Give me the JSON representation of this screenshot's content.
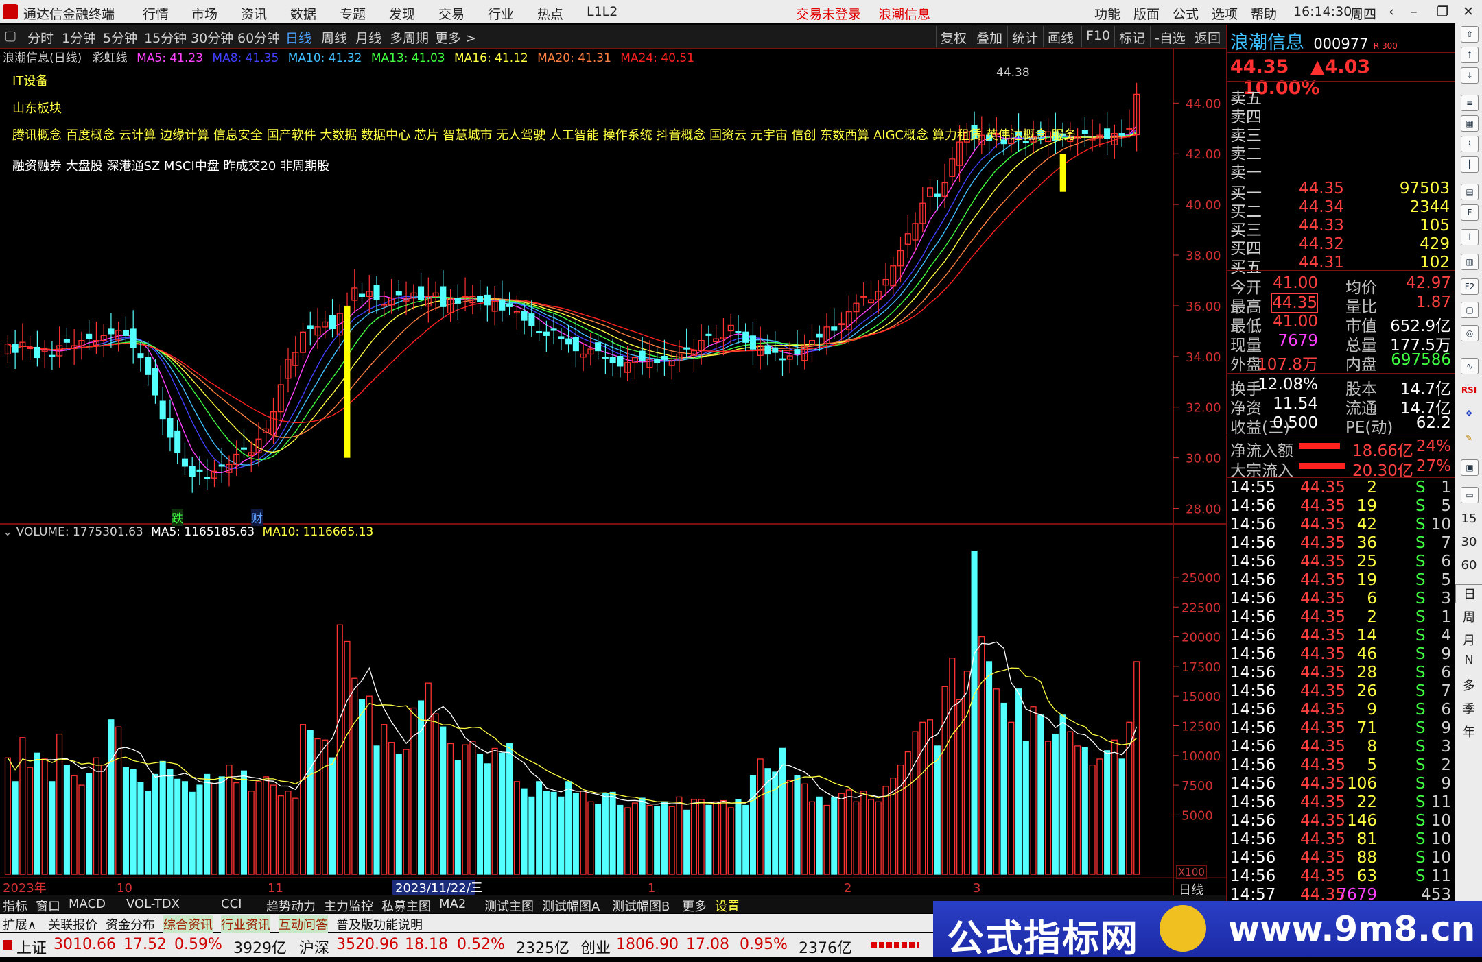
{
  "app": {
    "title": "通达信金融终端",
    "menu": [
      "行情",
      "市场",
      "资讯",
      "数据",
      "专题",
      "发现",
      "交易",
      "行业",
      "热点",
      "L1L2"
    ],
    "status_left": "交易未登录",
    "status_right": "浪潮信息",
    "right_menu": [
      "功能",
      "版面",
      "公式",
      "选项",
      "帮助"
    ],
    "clock": "16:14:30",
    "weekday": "周四"
  },
  "toolbar": {
    "periods": [
      "分时",
      "1分钟",
      "5分钟",
      "15分钟",
      "30分钟",
      "60分钟",
      "日线",
      "周线",
      "月线",
      "多周期",
      "更多 >"
    ],
    "active": "日线",
    "right_buttons": [
      "复权",
      "叠加",
      "统计",
      "画线",
      "F10",
      "标记",
      "-自选",
      "返回"
    ]
  },
  "chart_header": {
    "stock": "浪潮信息(日线)",
    "indicator": "彩虹线",
    "ma": [
      {
        "label": "MA5: 41.23",
        "color": "#ff40ff"
      },
      {
        "label": "MA8: 41.35",
        "color": "#4040ff"
      },
      {
        "label": "MA10: 41.32",
        "color": "#40c0ff"
      },
      {
        "label": "MA13: 41.03",
        "color": "#40ff40"
      },
      {
        "label": "MA16: 41.12",
        "color": "#ffff40"
      },
      {
        "label": "MA20: 41.31",
        "color": "#ff8040"
      },
      {
        "label": "MA24: 40.51",
        "color": "#ff2020"
      }
    ]
  },
  "tags": {
    "line1": "IT设备",
    "line2": "山东板块",
    "line3": "腾讯概念 百度概念 云计算 边缘计算 信息安全 国产软件 大数据 数据中心 芯片 智慧城市 无人驾驶 人工智能 操作系统 抖音概念 国资云 元宇宙 信创 东数西算 AIGC概念 算力租赁 英伟达概念 服务",
    "line4": "融资融券 大盘股 深港通SZ MSCI中盘 昨成交20 非周期股"
  },
  "chart_data": [
    {
      "type": "line",
      "name": "price",
      "y_ticks": [
        "44.00",
        "42.00",
        "40.00",
        "38.00",
        "36.00",
        "34.00",
        "32.00",
        "30.00",
        "28.00"
      ],
      "ylim": [
        27.5,
        45.2
      ],
      "high_label": "44.38",
      "markers": [
        "跌",
        "财"
      ]
    },
    {
      "type": "bar",
      "name": "volume",
      "title": "VOLUME: 1775301.63",
      "ma5": "MA5: 1165185.63",
      "ma10": "MA10: 1116665.13",
      "y_ticks": [
        "25000",
        "22500",
        "20000",
        "17500",
        "15000",
        "12500",
        "10000",
        "7500",
        "5000"
      ],
      "unit": "X100",
      "x_labels": [
        "2023年",
        "10",
        "11",
        "2023/11/22/三",
        "1",
        "2",
        "3"
      ],
      "period_label": "日线",
      "volumes": [
        9800,
        7800,
        11500,
        9000,
        10200,
        9700,
        7800,
        11800,
        9200,
        8300,
        7500,
        8500,
        9800,
        9200,
        13000,
        12400,
        9000,
        8800,
        7700,
        7000,
        8400,
        9500,
        8800,
        8000,
        7800,
        6900,
        7500,
        8400,
        7600,
        8200,
        9200,
        7700,
        8700,
        7000,
        7800,
        8200,
        7500,
        6600,
        7000,
        6400,
        12600,
        12100,
        11400,
        11300,
        9800,
        21000,
        19600,
        16500,
        14700,
        15000,
        10800,
        12600,
        11100,
        10100,
        10500,
        14000,
        14600,
        16100,
        13500,
        12400,
        11000,
        9600,
        10900,
        11200,
        10100,
        9300,
        10600,
        10200,
        11000,
        7800,
        7200,
        6500,
        7800,
        7000,
        6900,
        6500,
        7800,
        6800,
        7000,
        6100,
        5900,
        6800,
        6900,
        5800,
        5600,
        6000,
        6400,
        5800,
        5700,
        6100,
        5700,
        6500,
        5400,
        6300,
        6300,
        5800,
        6100,
        6200,
        5600,
        6300,
        5800,
        8300,
        9700,
        8900,
        8600,
        10600,
        7900,
        8300,
        7600,
        6100,
        6500,
        5800,
        6500,
        6800,
        7100,
        6100,
        7000,
        6300,
        6100,
        7400,
        8100,
        9200,
        10300,
        12000,
        12800,
        13000,
        10800,
        15800,
        18200,
        14700,
        17100,
        27200,
        20000,
        17900,
        15600,
        14400,
        12800,
        15600,
        11200,
        14100,
        13400,
        11200,
        11800,
        13400,
        12000,
        10800,
        10700,
        9200,
        9700,
        10400,
        11300,
        9700,
        12800,
        17900
      ]
    }
  ],
  "quote": {
    "name": "浪潮信息",
    "code": "000977",
    "code_mark": "R 300",
    "price": "44.35",
    "change": "▲4.03",
    "pct": "10.00%",
    "sell": [
      {
        "k": "卖五"
      },
      {
        "k": "卖四"
      },
      {
        "k": "卖三"
      },
      {
        "k": "卖二"
      },
      {
        "k": "卖一"
      }
    ],
    "buy": [
      {
        "k": "买一",
        "p": "44.35",
        "v": "97503"
      },
      {
        "k": "买二",
        "p": "44.34",
        "v": "2344"
      },
      {
        "k": "买三",
        "p": "44.33",
        "v": "105"
      },
      {
        "k": "买四",
        "p": "44.32",
        "v": "429"
      },
      {
        "k": "买五",
        "p": "44.31",
        "v": "102"
      }
    ],
    "stats": [
      {
        "l1": "今开",
        "v1": "41.00",
        "l2": "均价",
        "v2": "42.97"
      },
      {
        "l1": "最高",
        "v1": "44.35",
        "l2": "量比",
        "v2": "1.87"
      },
      {
        "l1": "最低",
        "v1": "41.00",
        "l2": "市值",
        "v2": "652.9亿"
      },
      {
        "l1": "现量",
        "v1": "7679",
        "l2": "总量",
        "v2": "177.5万"
      },
      {
        "l1": "外盘",
        "v1": "107.8万",
        "l2": "内盘",
        "v2": "697586"
      }
    ],
    "stats2": [
      {
        "l1": "换手",
        "v1": "12.08%",
        "l2": "股本",
        "v2": "14.7亿"
      },
      {
        "l1": "净资",
        "v1": "11.54",
        "l2": "流通",
        "v2": "14.7亿"
      },
      {
        "l1": "收益(三)",
        "v1": "0.500",
        "l2": "PE(动)",
        "v2": "62.2"
      }
    ],
    "flows": [
      {
        "l": "净流入额",
        "v": "18.66亿",
        "p": "24%"
      },
      {
        "l": "大宗流入",
        "v": "20.30亿",
        "p": "27%"
      }
    ],
    "ticks": [
      [
        "14:55",
        "44.35",
        "2",
        "S",
        "1"
      ],
      [
        "14:56",
        "44.35",
        "19",
        "S",
        "5"
      ],
      [
        "14:56",
        "44.35",
        "42",
        "S",
        "10"
      ],
      [
        "14:56",
        "44.35",
        "36",
        "S",
        "7"
      ],
      [
        "14:56",
        "44.35",
        "25",
        "S",
        "6"
      ],
      [
        "14:56",
        "44.35",
        "19",
        "S",
        "5"
      ],
      [
        "14:56",
        "44.35",
        "6",
        "S",
        "3"
      ],
      [
        "14:56",
        "44.35",
        "2",
        "S",
        "1"
      ],
      [
        "14:56",
        "44.35",
        "14",
        "S",
        "4"
      ],
      [
        "14:56",
        "44.35",
        "46",
        "S",
        "9"
      ],
      [
        "14:56",
        "44.35",
        "28",
        "S",
        "6"
      ],
      [
        "14:56",
        "44.35",
        "26",
        "S",
        "7"
      ],
      [
        "14:56",
        "44.35",
        "9",
        "S",
        "6"
      ],
      [
        "14:56",
        "44.35",
        "71",
        "S",
        "9"
      ],
      [
        "14:56",
        "44.35",
        "8",
        "S",
        "3"
      ],
      [
        "14:56",
        "44.35",
        "5",
        "S",
        "2"
      ],
      [
        "14:56",
        "44.35",
        "106",
        "S",
        "9"
      ],
      [
        "14:56",
        "44.35",
        "22",
        "S",
        "11"
      ],
      [
        "14:56",
        "44.35",
        "146",
        "S",
        "10"
      ],
      [
        "14:56",
        "44.35",
        "81",
        "S",
        "10"
      ],
      [
        "14:56",
        "44.35",
        "88",
        "S",
        "10"
      ],
      [
        "14:56",
        "44.35",
        "63",
        "S",
        "11"
      ],
      [
        "14:57",
        "44.35",
        "7679",
        "",
        "453"
      ]
    ]
  },
  "side_labels": [
    "15",
    "30",
    "60",
    "日",
    "周",
    "月",
    "N",
    "多",
    "季",
    "年"
  ],
  "bottom_tabs": [
    "指标",
    "窗口",
    "MACD",
    "VOL-TDX",
    "CCI",
    "趋势动力",
    "主力监控",
    "私募主图",
    "MA2",
    "测试主图",
    "测试幅图A",
    "测试幅图B",
    "更多",
    "设置"
  ],
  "bottom_tabs2": [
    "扩展∧",
    "关联报价",
    "资金分布",
    "综合资讯",
    "行业资讯",
    "互动问答",
    "普及版功能说明"
  ],
  "index_bar": [
    {
      "name": "上证",
      "v": "3010.66",
      "c": "17.52",
      "p": "0.59%",
      "amt": "3929亿"
    },
    {
      "name": "沪深",
      "v": "3520.96",
      "c": "18.18",
      "p": "0.52%",
      "amt": "2325亿"
    },
    {
      "name": "创业",
      "v": "1806.90",
      "c": "17.08",
      "p": "0.95%",
      "amt": "2376亿"
    }
  ],
  "ad": {
    "text1": "公式指标网",
    "text2": "www.9m8.cn"
  }
}
